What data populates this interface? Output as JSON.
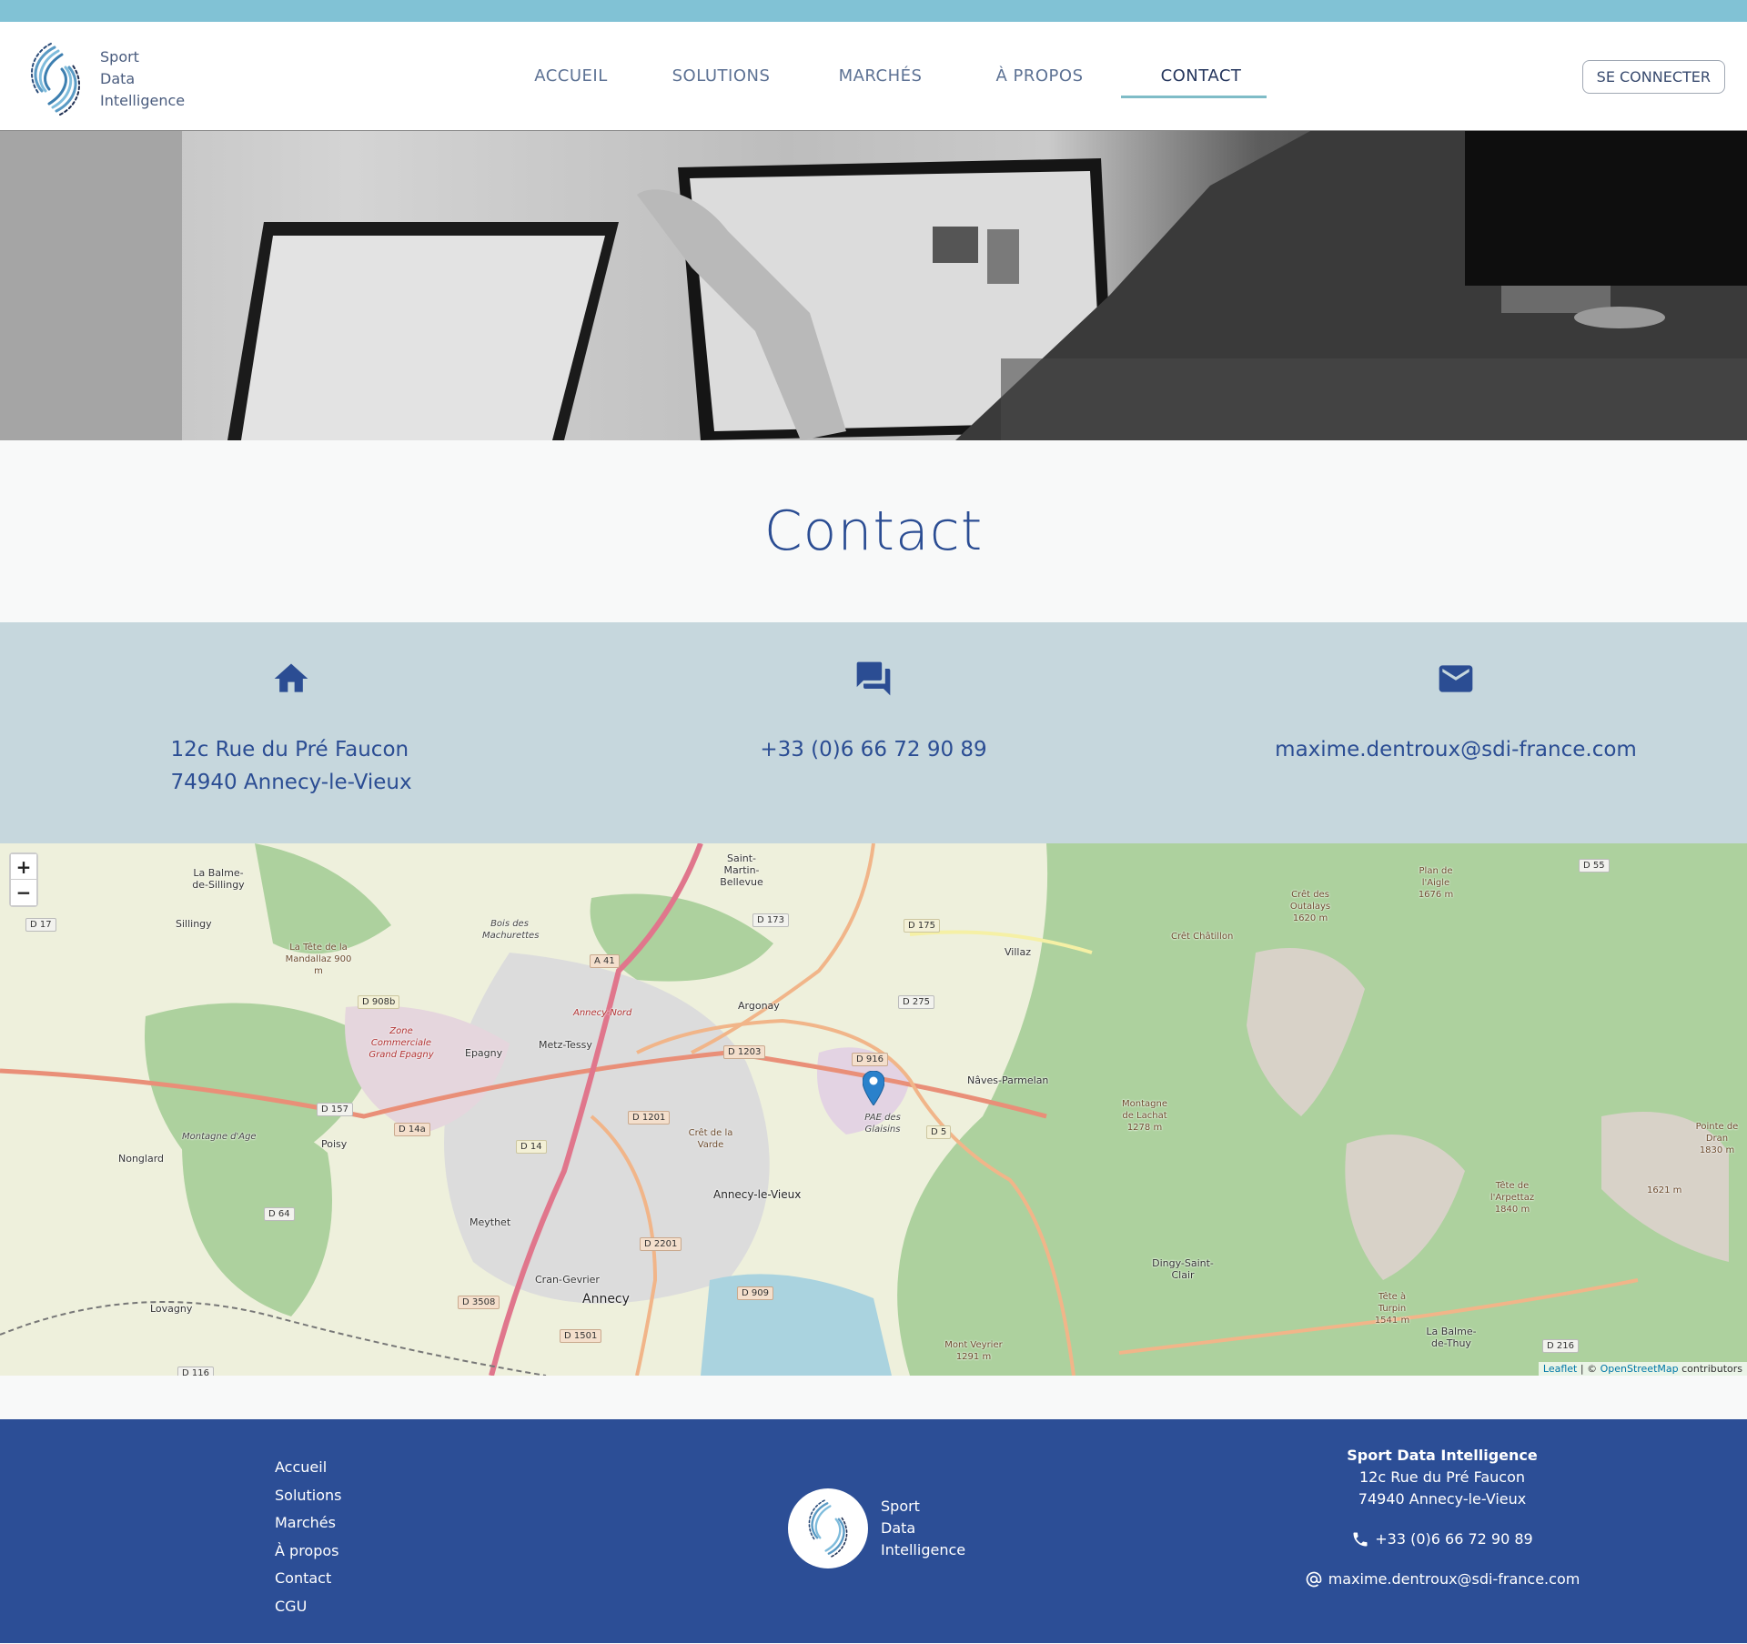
{
  "brand": {
    "name_lines": [
      "Sport",
      "Data",
      "Intelligence"
    ]
  },
  "nav": {
    "items": [
      {
        "label": "ACCUEIL",
        "active": false
      },
      {
        "label": "SOLUTIONS",
        "active": false
      },
      {
        "label": "MARCHÉS",
        "active": false
      },
      {
        "label": "À PROPOS",
        "active": false
      },
      {
        "label": "CONTACT",
        "active": true
      }
    ],
    "login_label": "SE CONNECTER"
  },
  "page": {
    "title": "Contact"
  },
  "colors": {
    "topbar": "#81c2d5",
    "primary": "#2b4d93",
    "info_bg": "#c6d7dd",
    "footer_bg": "#2c4e96",
    "active_underline": "#7fbcc7"
  },
  "contact_info": {
    "address": {
      "icon": "home-icon",
      "line1": "12c Rue du Pré Faucon",
      "line2": "74940 Annecy-le-Vieux"
    },
    "phone": {
      "icon": "chat-icon",
      "value": "+33 (0)6 66 72 90 89"
    },
    "email": {
      "icon": "mail-icon",
      "value": "maxime.dentroux@sdi-france.com"
    }
  },
  "map": {
    "zoom_in": "+",
    "zoom_out": "−",
    "marker_label": "PAE des Glaisins",
    "attribution": {
      "leaflet": "Leaflet",
      "sep": " | © ",
      "osm": "OpenStreetMap",
      "suffix": " contributors"
    },
    "places": [
      "La Balme-de-Sillingy",
      "Saint-Martin-Bellevue",
      "Sillingy",
      "La Tête de la Mandallaz 900 m",
      "Epagny",
      "Metz-Tessy",
      "Argonay",
      "Villaz",
      "Nâves-Parmelan",
      "Poisy",
      "Nonglard",
      "Montagne d'Age",
      "Meythet",
      "Cran-Gevrier",
      "Annecy",
      "Annecy-le-Vieux",
      "Lovagny",
      "Dingy-Saint-Clair",
      "La Balme-de-Thuy",
      "Crêt Châtillon",
      "Crêt des Outalays 1620 m",
      "Plan de l'Aigle 1676 m",
      "Montagne de Lachat 1278 m",
      "Tête de l'Arpettaz 1840 m",
      "Tête à Turpin 1541 m",
      "Pointe de Dran 1830 m",
      "1621 m",
      "Mont Veyrier 1291 m",
      "Crêt de la Varde",
      "Zone Commerciale Grand Epagny",
      "Annecy-Nord",
      "Bois des Machurettes"
    ],
    "roads": [
      "D 17",
      "D 908b",
      "D 157",
      "D 14a",
      "D 14",
      "D 64",
      "A 41",
      "D 173",
      "D 175",
      "D 275",
      "D 1203",
      "D 916",
      "D 1201",
      "D 5",
      "D 2201",
      "D 909",
      "D 3508",
      "D 1501",
      "D 55",
      "D 216",
      "D 116"
    ]
  },
  "footer": {
    "links": [
      "Accueil",
      "Solutions",
      "Marchés",
      "À propos",
      "Contact",
      "CGU"
    ],
    "brand_lines": [
      "Sport",
      "Data",
      "Intelligence"
    ],
    "company": "Sport Data Intelligence",
    "address1": "12c Rue du Pré Faucon",
    "address2": "74940 Annecy-le-Vieux",
    "phone": "+33 (0)6 66 72 90 89",
    "email": "maxime.dentroux@sdi-france.com"
  }
}
